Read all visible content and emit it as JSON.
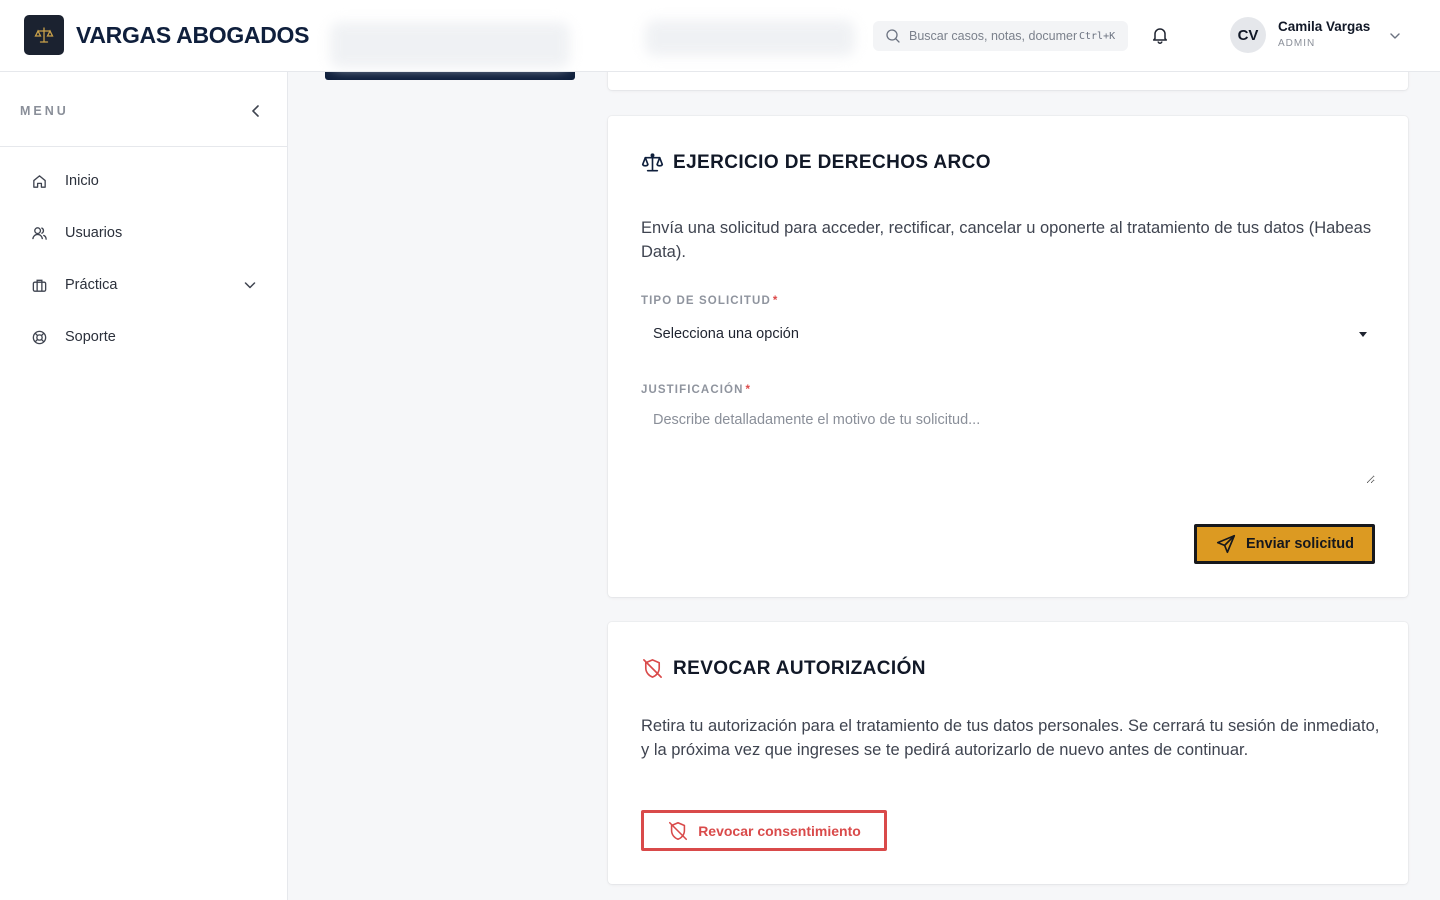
{
  "brand": {
    "name": "VARGAS ABOGADOS"
  },
  "search": {
    "placeholder": "Buscar casos, notas, documentos...",
    "shortcut": "Ctrl+K"
  },
  "user": {
    "initials": "CV",
    "name": "Camila Vargas",
    "role": "ADMIN"
  },
  "sidebar": {
    "menu_label": "MENU",
    "items": [
      {
        "label": "Inicio",
        "icon": "home-icon"
      },
      {
        "label": "Usuarios",
        "icon": "users-icon"
      },
      {
        "label": "Práctica",
        "icon": "briefcase-icon",
        "expandable": true
      },
      {
        "label": "Soporte",
        "icon": "lifebuoy-icon"
      }
    ]
  },
  "arco": {
    "title": "EJERCICIO DE DERECHOS ARCO",
    "description": "Envía una solicitud para acceder, rectificar, cancelar u oponerte al tratamiento de tus datos (Habeas Data).",
    "type_label": "TIPO DE SOLICITUD",
    "required_mark": "*",
    "type_value": "Selecciona una opción",
    "justification_label": "JUSTIFICACIÓN",
    "justification_placeholder": "Describe detalladamente el motivo de tu solicitud...",
    "submit_label": "Enviar solicitud"
  },
  "revoke": {
    "title": "REVOCAR AUTORIZACIÓN",
    "description": "Retira tu autorización para el tratamiento de tus datos personales. Se cerrará tu sesión de inmediato, y la próxima vez que ingreses se te pedirá autorizarlo de nuevo antes de continuar.",
    "button_label": "Revocar consentimiento"
  },
  "colors": {
    "brand_navy": "#0f1f3c",
    "accent_gold": "#dc9a22",
    "danger_red": "#d94a4a"
  }
}
